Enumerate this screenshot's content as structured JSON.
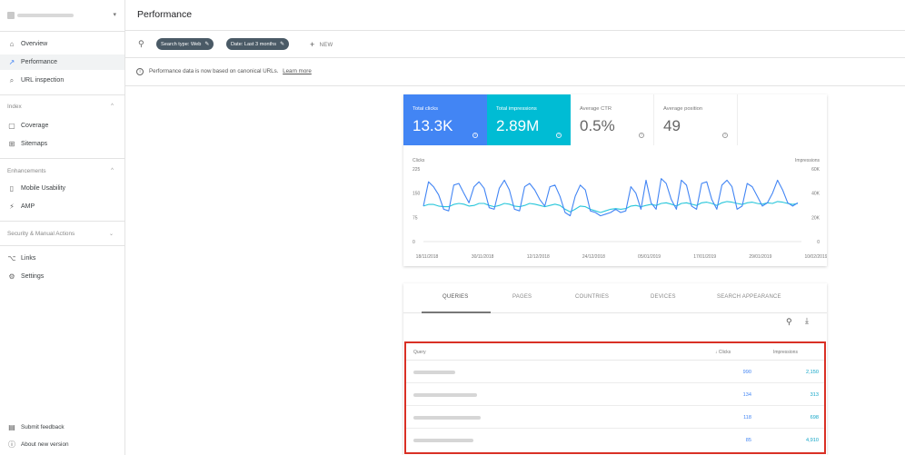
{
  "header": {
    "title": "Performance"
  },
  "sidebar": {
    "items": [
      {
        "label": "Overview",
        "icon": "home-icon"
      },
      {
        "label": "Performance",
        "icon": "trending-up-icon",
        "active": true
      },
      {
        "label": "URL inspection",
        "icon": "search-icon"
      }
    ],
    "sections": [
      {
        "title": "Index",
        "items": [
          {
            "label": "Coverage",
            "icon": "document-icon"
          },
          {
            "label": "Sitemaps",
            "icon": "sitemap-icon"
          }
        ]
      },
      {
        "title": "Enhancements",
        "items": [
          {
            "label": "Mobile Usability",
            "icon": "phone-icon"
          },
          {
            "label": "AMP",
            "icon": "amp-icon"
          }
        ]
      },
      {
        "title": "Security & Manual Actions",
        "items": []
      }
    ],
    "extra": [
      {
        "label": "Links",
        "icon": "links-icon"
      },
      {
        "label": "Settings",
        "icon": "gear-icon"
      }
    ],
    "bottom": [
      {
        "label": "Submit feedback",
        "icon": "feedback-icon"
      },
      {
        "label": "About new version",
        "icon": "info-icon"
      }
    ]
  },
  "filters": {
    "chips": [
      {
        "label": "Search type: Web"
      },
      {
        "label": "Date: Last 3 months"
      }
    ],
    "new_label": "NEW"
  },
  "info": {
    "text": "Performance data is now based on canonical URLs.",
    "link": "Learn more"
  },
  "metrics": [
    {
      "label": "Total clicks",
      "value": "13.3K",
      "color": "#4285f4"
    },
    {
      "label": "Total impressions",
      "value": "2.89M",
      "color": "#00bcd4"
    },
    {
      "label": "Average CTR",
      "value": "0.5%"
    },
    {
      "label": "Average position",
      "value": "49"
    }
  ],
  "chart_data": {
    "type": "line",
    "ylabel_left": "Clicks",
    "ylabel_right": "Impressions",
    "left_ticks": [
      "225",
      "150",
      "75",
      "0"
    ],
    "right_ticks": [
      "60K",
      "40K",
      "20K",
      "0"
    ],
    "x_ticks": [
      "18/11/2018",
      "30/11/2018",
      "12/12/2018",
      "24/12/2018",
      "05/01/2019",
      "17/01/2019",
      "29/01/2019",
      "10/02/2019"
    ],
    "ylim_left": [
      0,
      225
    ],
    "ylim_right": [
      0,
      60000
    ],
    "series": [
      {
        "name": "Clicks",
        "color": "#4285f4",
        "axis": "left",
        "values": [
          110,
          185,
          170,
          145,
          100,
          95,
          175,
          180,
          150,
          120,
          170,
          185,
          165,
          105,
          100,
          165,
          190,
          160,
          100,
          95,
          170,
          180,
          160,
          130,
          110,
          170,
          175,
          140,
          90,
          80,
          140,
          175,
          160,
          95,
          90,
          80,
          85,
          90,
          100,
          90,
          95,
          170,
          150,
          100,
          190,
          120,
          100,
          195,
          180,
          130,
          100,
          190,
          175,
          110,
          100,
          180,
          185,
          130,
          100,
          175,
          190,
          170,
          100,
          110,
          180,
          170,
          140,
          110,
          120,
          150,
          190,
          160,
          120,
          110,
          120
        ]
      },
      {
        "name": "Impressions",
        "color": "#26c6da",
        "axis": "left",
        "values": [
          110,
          115,
          115,
          110,
          108,
          108,
          115,
          118,
          116,
          110,
          112,
          118,
          118,
          112,
          108,
          112,
          118,
          116,
          110,
          108,
          112,
          118,
          116,
          112,
          108,
          112,
          116,
          112,
          100,
          92,
          100,
          110,
          108,
          100,
          95,
          90,
          95,
          100,
          102,
          100,
          102,
          110,
          112,
          108,
          112,
          115,
          112,
          118,
          120,
          116,
          110,
          118,
          120,
          116,
          112,
          120,
          122,
          118,
          112,
          120,
          124,
          122,
          118,
          115,
          120,
          122,
          118,
          116,
          120,
          118,
          124,
          122,
          118,
          115,
          118
        ]
      }
    ]
  },
  "queries": {
    "tabs": [
      "QUERIES",
      "PAGES",
      "COUNTRIES",
      "DEVICES",
      "SEARCH APPEARANCE"
    ],
    "columns": {
      "query": "Query",
      "clicks": "Clicks",
      "impressions": "Impressions"
    },
    "rows": [
      {
        "clicks": "990",
        "impressions": "2,150"
      },
      {
        "clicks": "134",
        "impressions": "313"
      },
      {
        "clicks": "118",
        "impressions": "698"
      },
      {
        "clicks": "85",
        "impressions": "4,910"
      }
    ]
  }
}
